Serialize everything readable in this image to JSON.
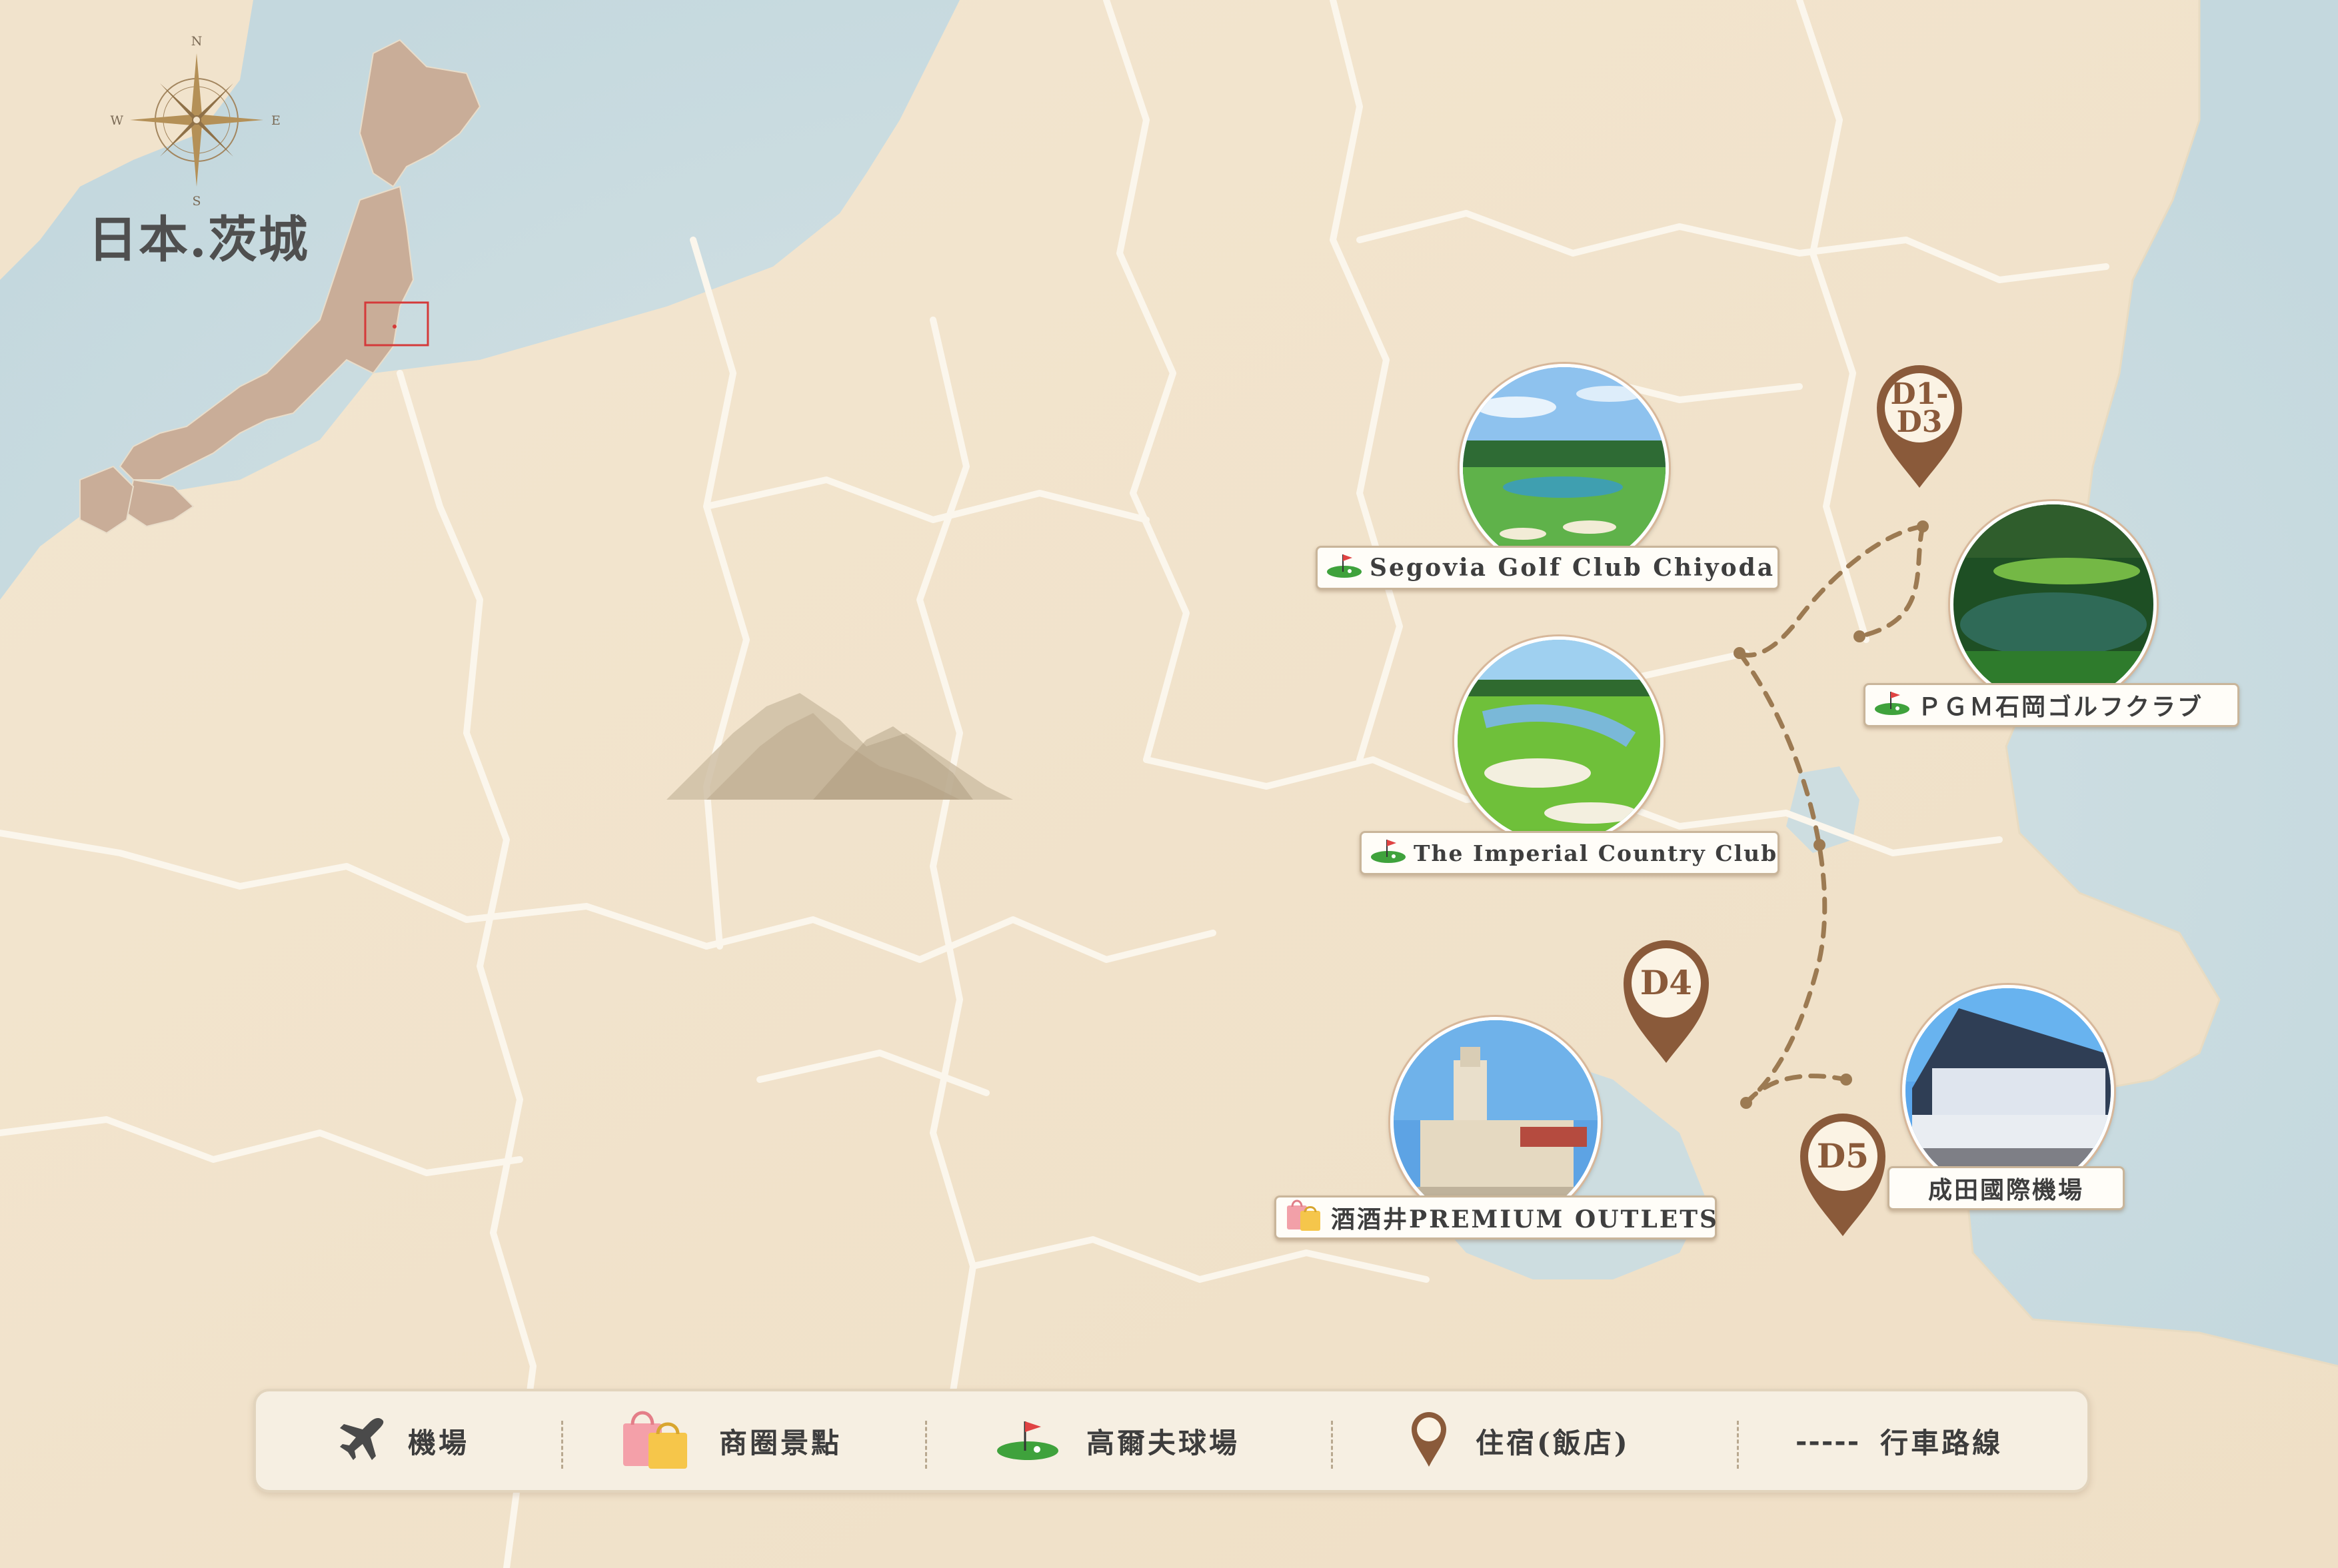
{
  "map": {
    "title": "日本.茨城",
    "compass": {
      "north": "N",
      "south": "S",
      "east": "E",
      "west": "W"
    }
  },
  "places": [
    {
      "name": "Segovia Golf Club Chiyoda",
      "category": "golf-course",
      "icon": "golf-flag-icon"
    },
    {
      "name": "ＰＧＭ石岡ゴルフクラブ",
      "category": "golf-course",
      "icon": "golf-flag-icon"
    },
    {
      "name": "The Imperial Country Club",
      "category": "golf-course",
      "icon": "golf-flag-icon"
    },
    {
      "name": "酒酒井PREMIUM OUTLETS",
      "category": "shopping",
      "icon": "shopping-bag-icon"
    },
    {
      "name": "成田國際機場",
      "category": "airport",
      "icon": ""
    }
  ],
  "markers": [
    {
      "label_line1": "D1-",
      "label_line2": "D3"
    },
    {
      "label_line1": "D4",
      "label_line2": ""
    },
    {
      "label_line1": "D5",
      "label_line2": ""
    }
  ],
  "legend": {
    "airport": "機場",
    "shopping": "商圈景點",
    "golf": "高爾夫球場",
    "hotel": "住宿(飯店)",
    "route_symbol": "-----",
    "route": "行車路線"
  },
  "colors": {
    "land": "#f1e3cc",
    "sea": "#cfdfe3",
    "borders": "#fbf6ec",
    "marker": "#8a5a3a",
    "route": "#9c7a52",
    "title": "#4f4f4f"
  }
}
